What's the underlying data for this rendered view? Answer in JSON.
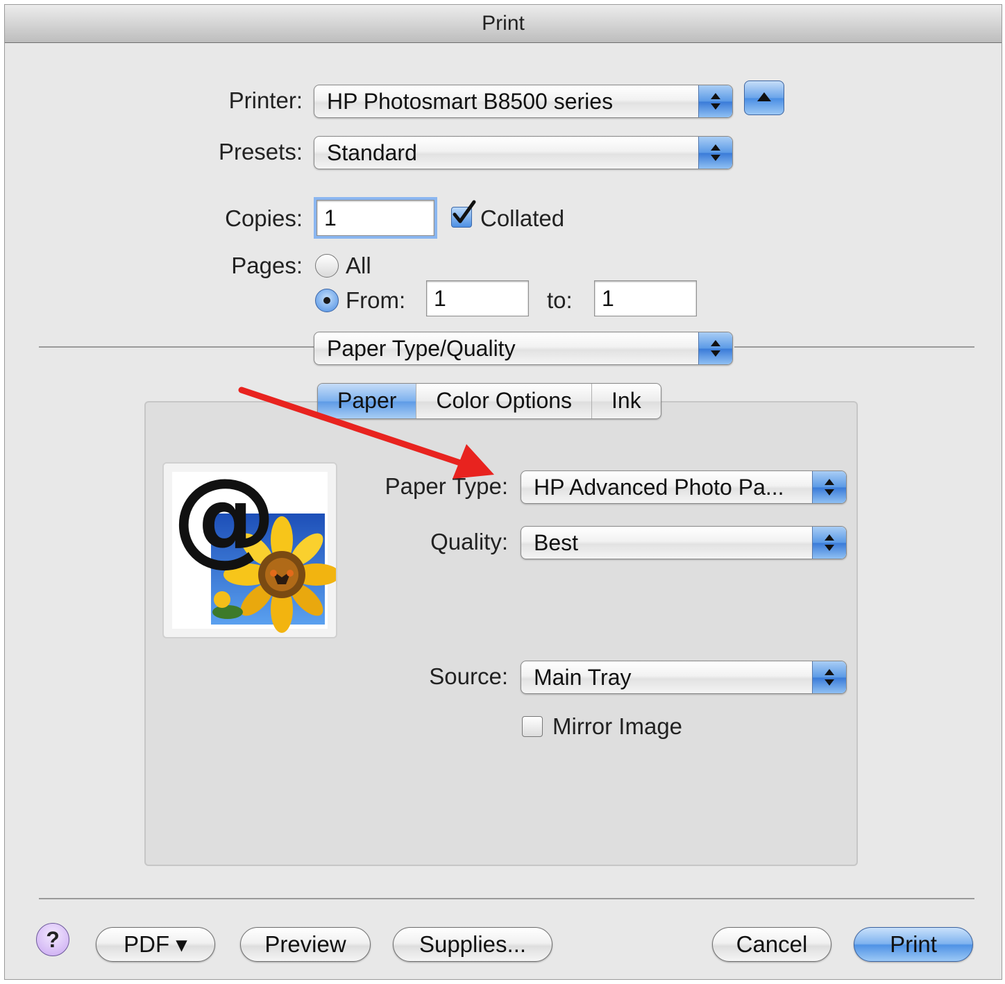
{
  "window": {
    "title": "Print"
  },
  "printer": {
    "label": "Printer:",
    "value": "HP Photosmart B8500 series"
  },
  "presets": {
    "label": "Presets:",
    "value": "Standard"
  },
  "copies": {
    "label": "Copies:",
    "value": "1",
    "collated_label": "Collated",
    "collated_checked": true
  },
  "pages": {
    "label": "Pages:",
    "all_label": "All",
    "from_label": "From:",
    "from_value": "1",
    "to_label": "to:",
    "to_value": "1",
    "selected": "from"
  },
  "section_popup": {
    "value": "Paper Type/Quality"
  },
  "tabs": [
    {
      "label": "Paper",
      "active": true
    },
    {
      "label": "Color Options",
      "active": false
    },
    {
      "label": "Ink",
      "active": false
    }
  ],
  "paper_type": {
    "label": "Paper Type:",
    "value": "HP Advanced Photo Pa..."
  },
  "quality": {
    "label": "Quality:",
    "value": "Best"
  },
  "source": {
    "label": "Source:",
    "value": "Main Tray"
  },
  "mirror_image": {
    "label": "Mirror Image",
    "checked": false
  },
  "preview": {
    "glyph": "@"
  },
  "footer": {
    "help": "?",
    "pdf": "PDF ▾",
    "preview": "Preview",
    "supplies": "Supplies...",
    "cancel": "Cancel",
    "print": "Print"
  },
  "colors": {
    "accent": "#4f92e5",
    "annotation_arrow": "#e8231f"
  }
}
